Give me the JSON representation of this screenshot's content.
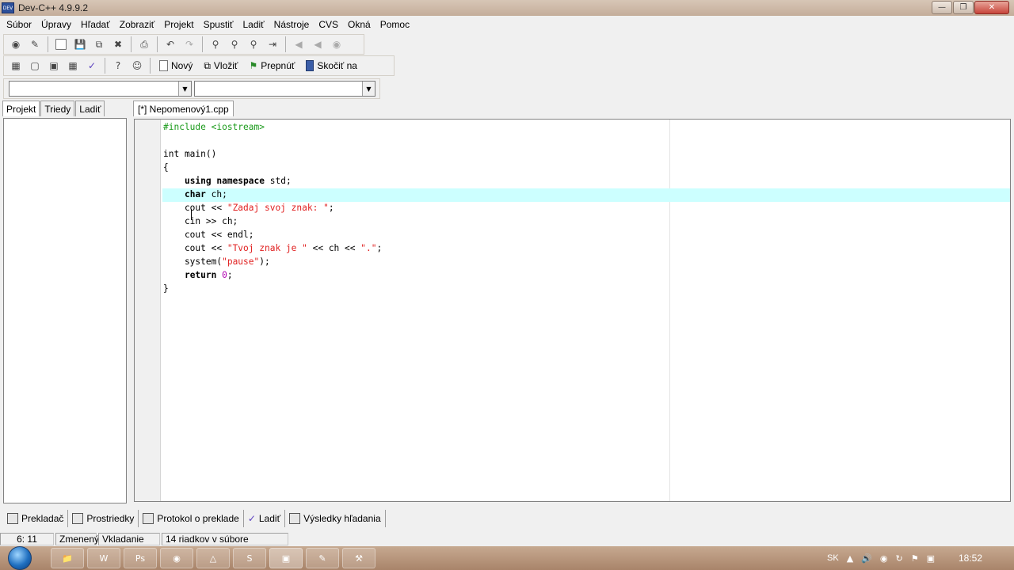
{
  "window": {
    "title": "Dev-C++ 4.9.9.2",
    "icon_text": "DEV"
  },
  "menu": [
    "Súbor",
    "Úpravy",
    "Hľadať",
    "Zobraziť",
    "Projekt",
    "Spustiť",
    "Ladiť",
    "Nástroje",
    "CVS",
    "Okná",
    "Pomoc"
  ],
  "toolbar2": {
    "new_label": "Nový",
    "insert_label": "Vložiť",
    "toggle_label": "Prepnúť",
    "goto_label": "Skočiť na"
  },
  "left_tabs": [
    "Projekt",
    "Triedy",
    "Ladiť"
  ],
  "file_tab": "[*] Nepomenový1.cpp",
  "code_lines": [
    [
      {
        "t": "#include <iostream>",
        "c": "pp"
      }
    ],
    [],
    [
      {
        "t": "int main()",
        "c": ""
      }
    ],
    [
      {
        "t": "{",
        "c": ""
      }
    ],
    [
      {
        "t": "    ",
        "c": ""
      },
      {
        "t": "using namespace",
        "c": "kw"
      },
      {
        "t": " std;",
        "c": ""
      }
    ],
    [
      {
        "t": "    ",
        "c": ""
      },
      {
        "t": "char",
        "c": "kw"
      },
      {
        "t": " ch;",
        "c": ""
      }
    ],
    [
      {
        "t": "    cout << ",
        "c": ""
      },
      {
        "t": "\"Zadaj svoj znak: \"",
        "c": "str"
      },
      {
        "t": ";",
        "c": ""
      }
    ],
    [
      {
        "t": "    cin >> ch;",
        "c": ""
      }
    ],
    [
      {
        "t": "    cout << endl;",
        "c": ""
      }
    ],
    [
      {
        "t": "    cout << ",
        "c": ""
      },
      {
        "t": "\"Tvoj znak je \"",
        "c": "str"
      },
      {
        "t": " << ch << ",
        "c": ""
      },
      {
        "t": "\".\"",
        "c": "str"
      },
      {
        "t": ";",
        "c": ""
      }
    ],
    [
      {
        "t": "    system(",
        "c": ""
      },
      {
        "t": "\"pause\"",
        "c": "str"
      },
      {
        "t": ");",
        "c": ""
      }
    ],
    [
      {
        "t": "    ",
        "c": ""
      },
      {
        "t": "return",
        "c": "kw"
      },
      {
        "t": " ",
        "c": ""
      },
      {
        "t": "0",
        "c": "num"
      },
      {
        "t": ";",
        "c": ""
      }
    ],
    [
      {
        "t": "}",
        "c": ""
      }
    ]
  ],
  "bottom_tabs": [
    "Prekladač",
    "Prostriedky",
    "Protokol o preklade",
    "Ladiť",
    "Výsledky hľadania"
  ],
  "status": {
    "position": "6: 11",
    "modified": "Zmenený",
    "mode": "Vkladanie",
    "lines_info": "14 riadkov v súbore"
  },
  "taskbar": {
    "lang": "SK",
    "time": "18:52",
    "items": [
      "folder-icon",
      "word-icon",
      "photoshop-icon",
      "chrome-icon",
      "network-icon",
      "skype-icon",
      "devcpp-icon",
      "notepad-icon",
      "tools-icon"
    ]
  }
}
